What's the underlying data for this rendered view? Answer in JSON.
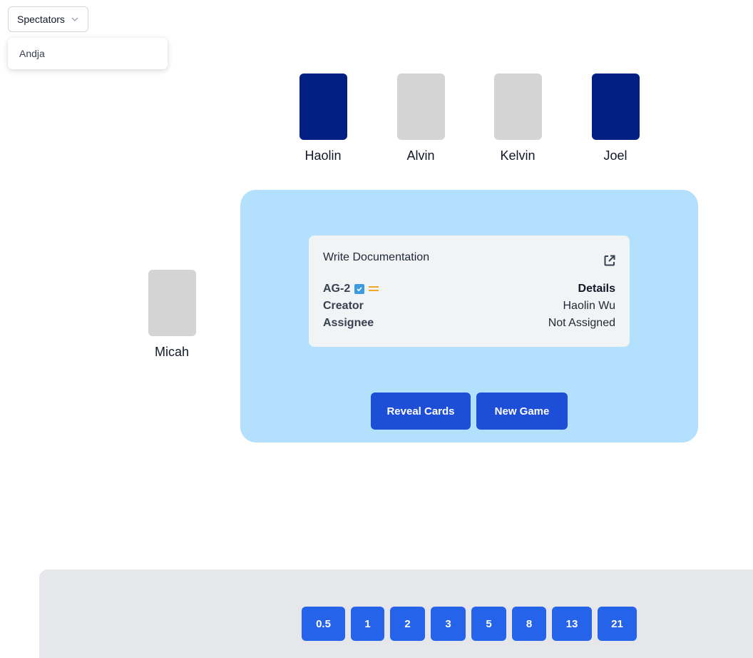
{
  "spectators": {
    "button_label": "Spectators",
    "items": [
      "Andja"
    ]
  },
  "players": [
    {
      "name": "Haolin",
      "card_state": "selected"
    },
    {
      "name": "Alvin",
      "card_state": "empty"
    },
    {
      "name": "Kelvin",
      "card_state": "empty"
    },
    {
      "name": "Joel",
      "card_state": "selected"
    },
    {
      "name": "Micah",
      "card_state": "empty"
    }
  ],
  "issue": {
    "title": "Write Documentation",
    "key": "AG-2",
    "details_label": "Details",
    "creator_label": "Creator",
    "creator": "Haolin Wu",
    "assignee_label": "Assignee",
    "assignee": "Not Assigned"
  },
  "actions": {
    "reveal_label": "Reveal Cards",
    "new_game_label": "New Game"
  },
  "deck": {
    "cards": [
      "0.5",
      "1",
      "2",
      "3",
      "5",
      "8",
      "13",
      "21"
    ]
  },
  "colors": {
    "selected_card": "#011e82",
    "empty_card": "#d4d4d4",
    "table": "#b3e0fc",
    "primary_button": "#1d4ed8",
    "deck_card": "#2563eb",
    "deck_background": "#e5e7eb"
  },
  "icons": {
    "dropdown": "chevron-down-icon",
    "external_link": "external-link-icon",
    "issue_type": "checkbox-icon",
    "priority": "priority-medium-icon"
  }
}
